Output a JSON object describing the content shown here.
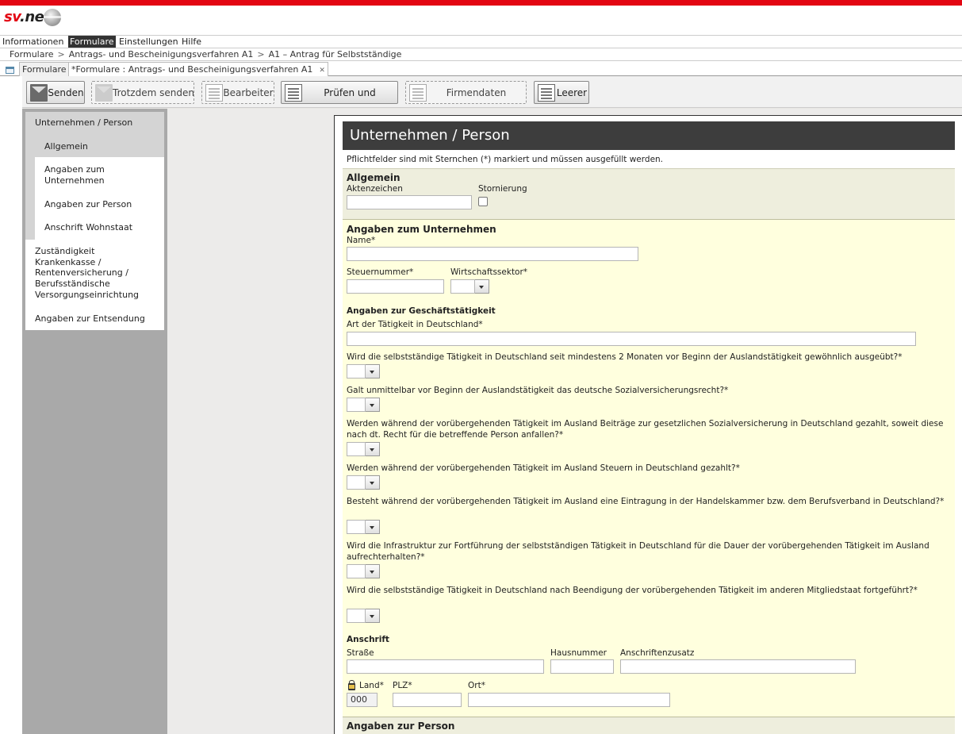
{
  "app": {
    "logo_sv": "sv",
    "logo_net": ".net"
  },
  "menu": [
    "Informationen",
    "Formulare",
    "Einstellungen",
    "Hilfe"
  ],
  "breadcrumb": [
    "Formulare",
    "Antrags- und Bescheinigungsverfahren A1",
    "A1 – Antrag für Selbstständige"
  ],
  "breadcrumb_sep": ">",
  "tabs": {
    "t1": "Formulare",
    "t2": "*Formulare : Antrags- und Bescheinigungsverfahren A1"
  },
  "toolbar": {
    "send": "Senden",
    "send_anyway": "Trotzdem senden",
    "edit": "Bearbeiter",
    "check": "Prüfen und",
    "company": "Firmendaten",
    "empty": "Leerer"
  },
  "nav": {
    "group": "Unternehmen / Person",
    "allgemein": "Allgemein",
    "unternehmen": "Angaben zum\nUnternehmen",
    "person": "Angaben zur Person",
    "wohnstaat": "Anschrift Wohnstaat",
    "zustaendig": "Zuständigkeit\nKrankenkasse /\nRentenversicherung /\nBerufsständische\nVersorgungseinrichtung",
    "entsendung": "Angaben zur Entsendung"
  },
  "form": {
    "title": "Unternehmen / Person",
    "hint": "Pflichtfelder sind mit Sternchen (*) markiert und müssen ausgefüllt werden.",
    "allgemein": {
      "heading": "Allgemein",
      "aktenzeichen": "Aktenzeichen",
      "stornierung": "Stornierung"
    },
    "unternehmen": {
      "heading": "Angaben zum Unternehmen",
      "name": "Name*",
      "steuernummer": "Steuernummer*",
      "wirtschaftssektor": "Wirtschaftssektor*",
      "geschaeft_heading": "Angaben zur Geschäftstätigkeit",
      "art": "Art der Tätigkeit in Deutschland*",
      "q1": "Wird die selbstständige Tätigkeit in Deutschland seit mindestens 2 Monaten vor Beginn der Auslandstätigkeit gewöhnlich ausgeübt?*",
      "q2": "Galt unmittelbar vor Beginn der Auslandstätigkeit das deutsche Sozialversicherungsrecht?*",
      "q3": "Werden während der vorübergehenden Tätigkeit im Ausland Beiträge zur gesetzlichen Sozialversicherung in Deutschland gezahlt, soweit diese nach dt. Recht für die betreffende Person anfallen?*",
      "q4": "Werden während der vorübergehenden Tätigkeit im Ausland Steuern in Deutschland gezahlt?*",
      "q5": "Besteht während der vorübergehenden Tätigkeit im Ausland eine Eintragung in der Handelskammer bzw. dem Berufsverband in Deutschland?*",
      "q6": "Wird die Infrastruktur zur Fortführung der selbstständigen Tätigkeit in Deutschland für die Dauer der vorübergehenden Tätigkeit im Ausland aufrechterhalten?*",
      "q7": "Wird die selbstständige Tätigkeit in Deutschland nach Beendigung der vorübergehenden Tätigkeit im anderen Mitgliedstaat fortgeführt?*",
      "anschrift": {
        "heading": "Anschrift",
        "strasse": "Straße",
        "hausnummer": "Hausnummer",
        "zusatz": "Anschriftenzusatz",
        "land": "Land*",
        "land_value": "000",
        "plz": "PLZ*",
        "ort": "Ort*"
      }
    },
    "person_heading": "Angaben zur Person"
  }
}
